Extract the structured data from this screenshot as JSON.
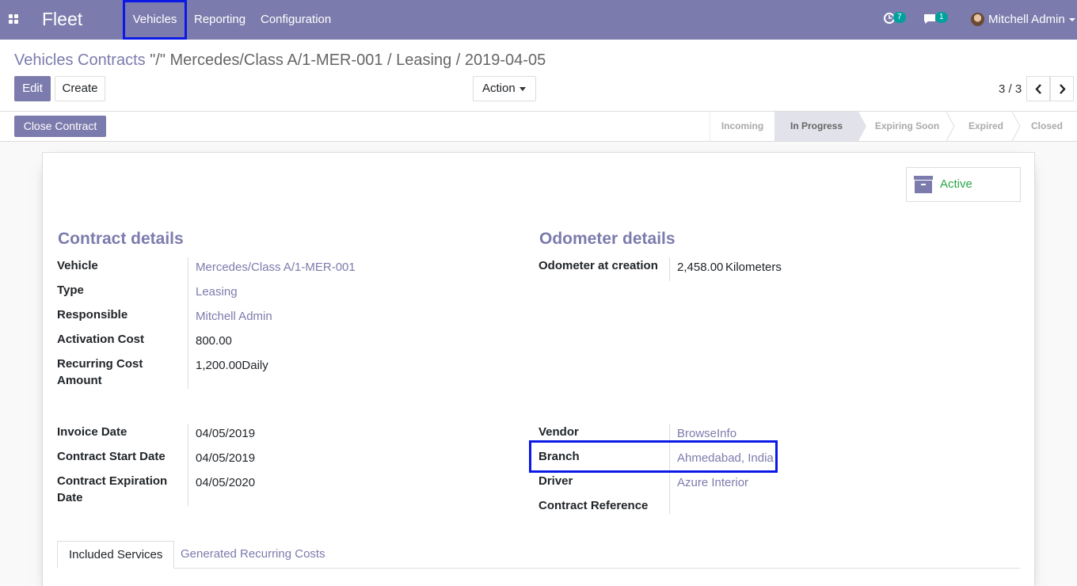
{
  "nav": {
    "brand": "Fleet",
    "menu": [
      "Vehicles",
      "Reporting",
      "Configuration"
    ],
    "activities_count": "7",
    "messages_count": "1",
    "user": "Mitchell Admin"
  },
  "breadcrumb": {
    "parent": "Vehicles Contracts",
    "current": "\"/\" Mercedes/Class A/1-MER-001 / Leasing / 2019-04-05"
  },
  "toolbar": {
    "edit": "Edit",
    "create": "Create",
    "action": "Action",
    "pager": "3 / 3"
  },
  "statusbar": {
    "close_contract": "Close Contract",
    "stages": [
      "Incoming",
      "In Progress",
      "Expiring Soon",
      "Expired",
      "Closed"
    ],
    "active_stage": "In Progress"
  },
  "form": {
    "active_label": "Active",
    "contract_title": "Contract details",
    "odometer_title": "Odometer details",
    "vehicle_label": "Vehicle",
    "vehicle": "Mercedes/Class A/1-MER-001",
    "type_label": "Type",
    "type": "Leasing",
    "responsible_label": "Responsible",
    "responsible": "Mitchell Admin",
    "activation_cost_label": "Activation Cost",
    "activation_cost": "800.00",
    "recurring_label": "Recurring Cost Amount",
    "recurring": "1,200.00Daily",
    "odometer_label": "Odometer at creation",
    "odometer_value": "2,458.00",
    "odometer_unit": "Kilometers",
    "invoice_date_label": "Invoice Date",
    "invoice_date": "04/05/2019",
    "start_date_label": "Contract Start Date",
    "start_date": "04/05/2019",
    "expiration_label": "Contract Expiration Date",
    "expiration": "04/05/2020",
    "vendor_label": "Vendor",
    "vendor": "BrowseInfo",
    "branch_label": "Branch",
    "branch": "Ahmedabad, India",
    "driver_label": "Driver",
    "driver": "Azure Interior",
    "reference_label": "Contract Reference",
    "reference": ""
  },
  "tabs": [
    "Included Services",
    "Generated Recurring Costs"
  ],
  "colors": {
    "primary": "#7c7bad",
    "highlight": "#0a19e6",
    "badge": "#00a09d",
    "active_green": "#28a745"
  }
}
